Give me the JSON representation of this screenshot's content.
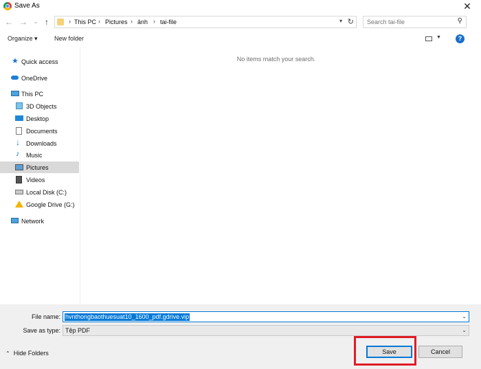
{
  "window": {
    "title": "Save As",
    "close_glyph": "✕",
    "app_icon": "chrome-icon"
  },
  "address": {
    "crumbs": [
      "This PC",
      "Pictures",
      "ảnh",
      "tai-file"
    ],
    "separator": "›",
    "search_placeholder": "Search tai-file"
  },
  "toolbar": {
    "organize": "Organize ▾",
    "new_folder": "New folder",
    "help": "?"
  },
  "nav": {
    "quick_access": "Quick access",
    "onedrive": "OneDrive",
    "this_pc": "This PC",
    "objects3d": "3D Objects",
    "desktop": "Desktop",
    "documents": "Documents",
    "downloads": "Downloads",
    "music": "Music",
    "pictures": "Pictures",
    "videos": "Videos",
    "local_disk": "Local Disk (C:)",
    "google_drive": "Google Drive (G:)",
    "network": "Network"
  },
  "content": {
    "empty_message": "No items match your search."
  },
  "form": {
    "filename_label": "File name:",
    "filename_value": "hvnthongbaothuesuat10_1600_pdf.gdrive.vip",
    "type_label": "Save as type:",
    "type_value": "Tệp PDF"
  },
  "footer": {
    "hide_folders": "Hide Folders",
    "save": "Save",
    "cancel": "Cancel"
  },
  "colors": {
    "accent": "#0078d7",
    "highlight": "#e01b24"
  }
}
